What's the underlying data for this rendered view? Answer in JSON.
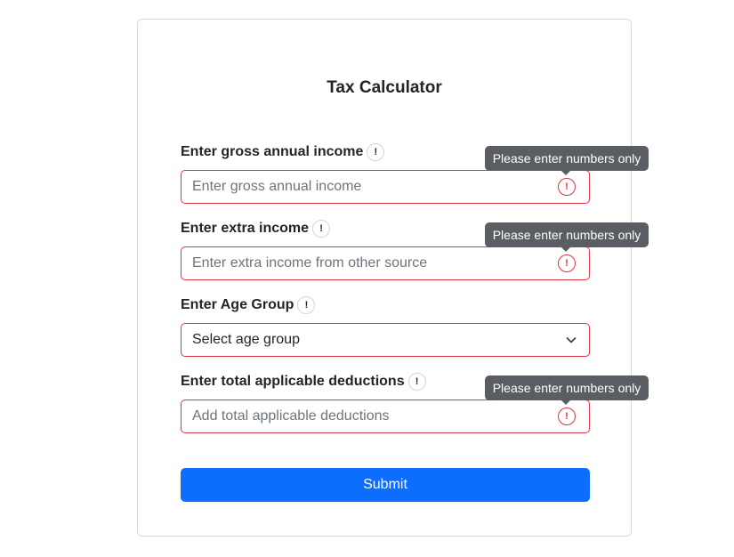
{
  "form": {
    "title": "Tax Calculator",
    "fields": [
      {
        "label": "Enter gross annual income",
        "info_icon": "!",
        "placeholder": "Enter gross annual income",
        "value": "",
        "error_icon": "!",
        "tooltip": "Please enter numbers only"
      },
      {
        "label": "Enter extra income",
        "info_icon": "!",
        "placeholder": "Enter extra income from other source",
        "value": "",
        "error_icon": "!",
        "tooltip": "Please enter numbers only"
      },
      {
        "label": "Enter Age Group",
        "info_icon": "!",
        "selected": "Select age group"
      },
      {
        "label": "Enter total applicable deductions",
        "info_icon": "!",
        "placeholder": "Add total applicable deductions",
        "value": "",
        "error_icon": "!",
        "tooltip": "Please enter numbers only"
      }
    ],
    "submit_label": "Submit"
  },
  "icons": {
    "info": "info-icon",
    "error": "error-icon",
    "dropdown": "chevron-down-icon"
  },
  "colors": {
    "primary": "#0d6efd",
    "error": "#dc3545",
    "tooltip_bg": "#5a5e63",
    "text": "#212529",
    "placeholder": "#6c757d"
  }
}
